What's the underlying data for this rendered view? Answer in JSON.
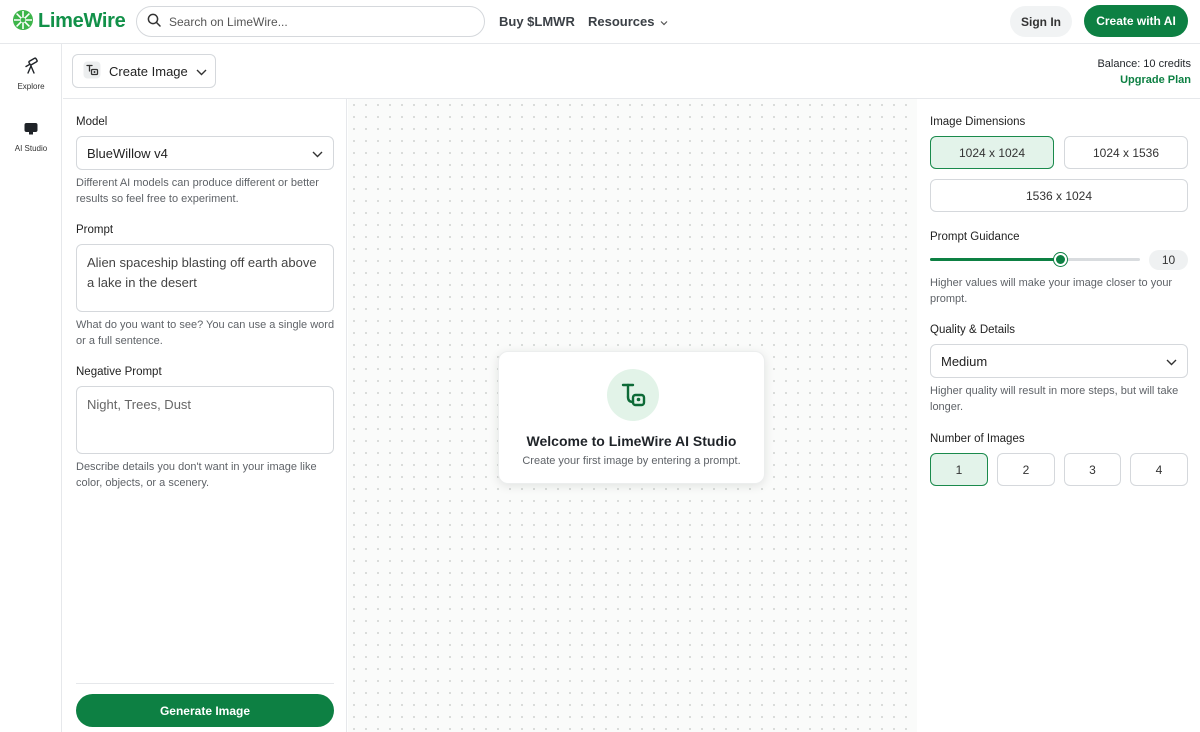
{
  "header": {
    "logo_text": "LimeWire",
    "search_placeholder": "Search on LimeWire...",
    "nav": {
      "buy": "Buy $LMWR",
      "resources": "Resources"
    },
    "sign_in": "Sign In",
    "create_with_ai": "Create with AI"
  },
  "rail": {
    "items": [
      {
        "label": "Explore",
        "icon": "telescope-icon"
      },
      {
        "label": "AI Studio",
        "icon": "monitor-icon"
      }
    ]
  },
  "subheader": {
    "mode": "Create Image",
    "balance": "Balance: 10 credits",
    "upgrade": "Upgrade Plan"
  },
  "left": {
    "model_label": "Model",
    "model_value": "BlueWillow v4",
    "model_hint": "Different AI models can produce different or better results so feel free to experiment.",
    "prompt_label": "Prompt",
    "prompt_value": "Alien spaceship blasting off earth above a lake in the desert",
    "prompt_hint": "What do you want to see? You can use a single word or a full sentence.",
    "negative_label": "Negative Prompt",
    "negative_placeholder": "Night, Trees, Dust",
    "negative_hint": "Describe details you don't want in your image like color, objects, or a scenery.",
    "generate": "Generate Image"
  },
  "canvas": {
    "welcome_title": "Welcome to LimeWire AI Studio",
    "welcome_sub": "Create your first image by entering a prompt."
  },
  "right": {
    "dimensions_label": "Image Dimensions",
    "dimensions": [
      "1024 x 1024",
      "1024 x 1536",
      "1536 x 1024"
    ],
    "dimensions_selected": "1024 x 1024",
    "guidance_label": "Prompt Guidance",
    "guidance_value": "10",
    "guidance_level": 0.62,
    "guidance_hint": "Higher values will make your image closer to your prompt.",
    "quality_label": "Quality & Details",
    "quality_value": "Medium",
    "quality_hint": "Higher quality will result in more steps, but will take longer.",
    "count_label": "Number of Images",
    "counts": [
      "1",
      "2",
      "3",
      "4"
    ],
    "count_selected": "1"
  },
  "colors": {
    "brand_green": "#0d8043",
    "selected_bg": "#e3f3ea"
  }
}
